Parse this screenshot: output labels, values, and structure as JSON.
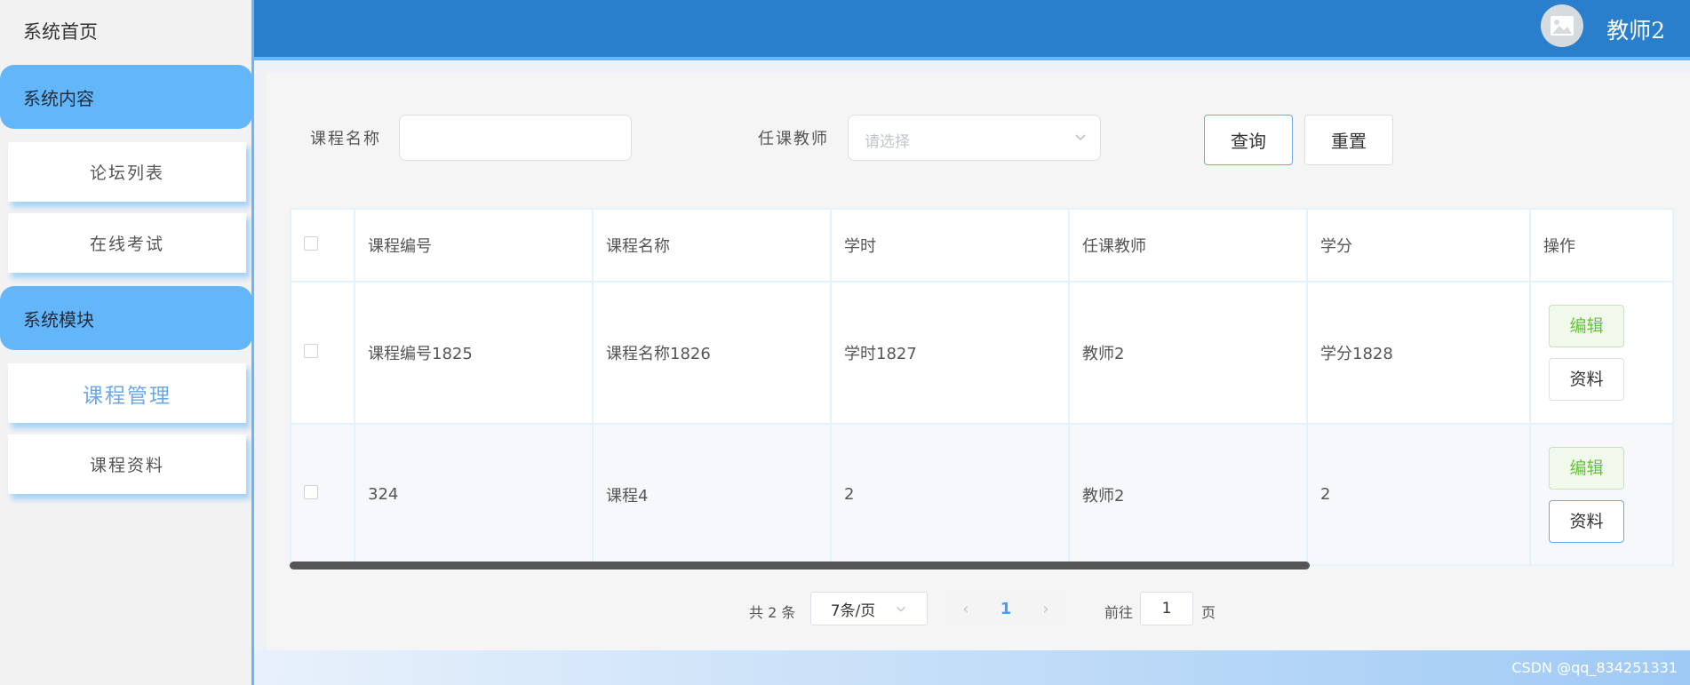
{
  "sidebar": {
    "home": "系统首页",
    "groups": [
      {
        "label": "系统内容",
        "items": [
          {
            "label": "论坛列表"
          },
          {
            "label": "在线考试"
          }
        ]
      },
      {
        "label": "系统模块",
        "items": [
          {
            "label": "课程管理"
          },
          {
            "label": "课程资料"
          }
        ]
      }
    ]
  },
  "header": {
    "username": "教师2"
  },
  "search": {
    "course_name_label": "课程名称",
    "course_name_value": "",
    "teacher_label": "任课教师",
    "teacher_placeholder": "请选择",
    "query_button": "查询",
    "reset_button": "重置"
  },
  "table": {
    "headers": [
      "课程编号",
      "课程名称",
      "学时",
      "任课教师",
      "学分",
      "操作"
    ],
    "rows": [
      {
        "code": "课程编号1825",
        "name": "课程名称1826",
        "hours": "学时1827",
        "teacher": "教师2",
        "credit": "学分1828"
      },
      {
        "code": "324",
        "name": "课程4",
        "hours": "2",
        "teacher": "教师2",
        "credit": "2"
      }
    ],
    "edit_button": "编辑",
    "material_button": "资料"
  },
  "pagination": {
    "total_text": "共 2 条",
    "page_size": "7条/页",
    "current_page": "1",
    "goto_prefix": "前往",
    "goto_value": "1",
    "goto_suffix": "页"
  },
  "watermark": "CSDN @qq_834251331",
  "colors": {
    "accent": "#2a7fcc",
    "sidebar_group": "#64b6fa",
    "edit_green": "#67c23a"
  }
}
